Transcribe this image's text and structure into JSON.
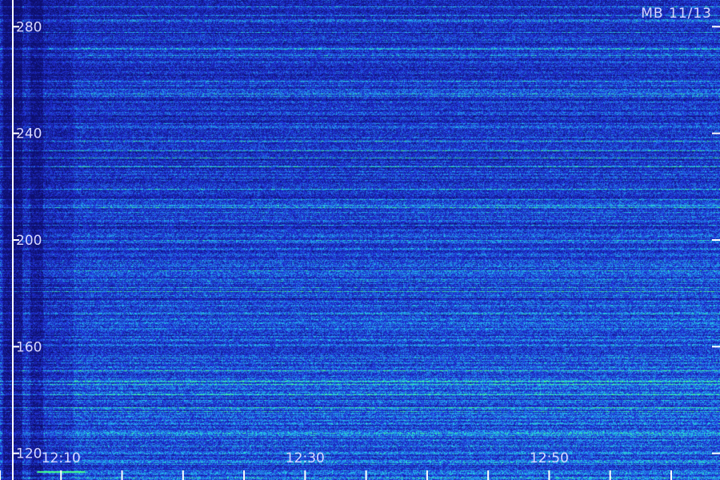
{
  "chart_data": {
    "type": "heatmap",
    "label": "MB 11/13",
    "y_axis": {
      "ticks": [
        120,
        160,
        200,
        240,
        280
      ],
      "ylim": [
        110,
        290
      ]
    },
    "x_axis": {
      "labeled_ticks": [
        "12:10",
        "12:30",
        "12:50"
      ],
      "tick_interval_minutes": 5,
      "xlim": [
        "12:05",
        "13:04"
      ]
    },
    "features": {
      "dark_band_times": [
        "12:06",
        "12:08"
      ],
      "dark_zone_end": "12:11",
      "green_trace_time": "12:10",
      "green_trace_y": 113
    },
    "colors": {
      "background": "#0d0f6e",
      "mid": "#2233dd",
      "high": "#22ccee",
      "peak": "#44ff88",
      "axis": "#ffffff"
    }
  }
}
